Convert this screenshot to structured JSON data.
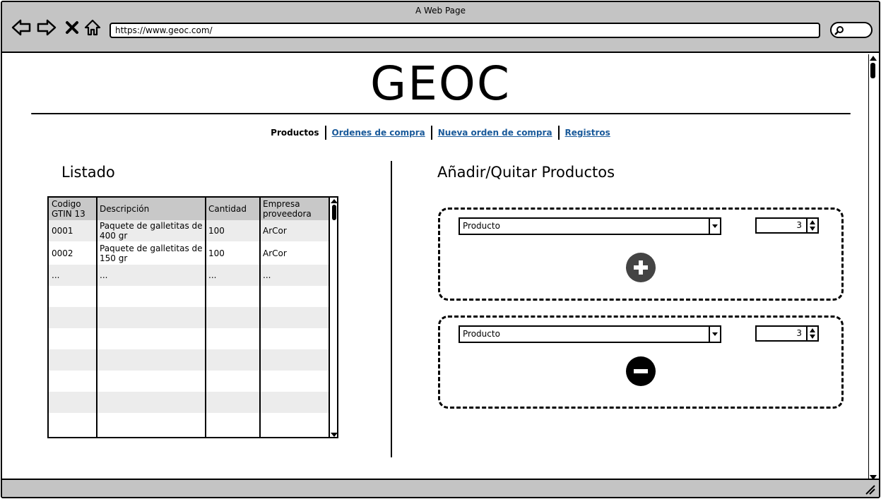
{
  "window": {
    "title": "A Web Page",
    "url": "https://www.geoc.com/"
  },
  "page": {
    "logo": "GEOC",
    "nav": {
      "current": "Productos",
      "links": [
        "Ordenes de compra",
        "Nueva orden de compra",
        "Registros"
      ]
    }
  },
  "listado": {
    "title": "Listado",
    "columns": [
      "Codigo GTIN 13",
      "Descripción",
      "Cantidad",
      "Empresa proveedora"
    ],
    "rows": [
      [
        "0001",
        "Paquete de galletitas de 400 gr",
        "100",
        "ArCor"
      ],
      [
        "0002",
        "Paquete de galletitas de 150 gr",
        "100",
        "ArCor"
      ],
      [
        "...",
        "...",
        "...",
        "..."
      ]
    ]
  },
  "editor": {
    "title": "Añadir/Quitar Productos",
    "add_panel": {
      "select_value": "Producto",
      "quantity": "3",
      "action_icon": "plus-circle-icon"
    },
    "remove_panel": {
      "select_value": "Producto",
      "quantity": "3",
      "action_icon": "minus-circle-icon"
    }
  },
  "colors": {
    "chrome": "#c4c4c4",
    "link": "#1a5a9a",
    "header_row": "#c8c8c8",
    "alt_row": "#ececec",
    "add_button": "#444444",
    "remove_button": "#000000"
  }
}
